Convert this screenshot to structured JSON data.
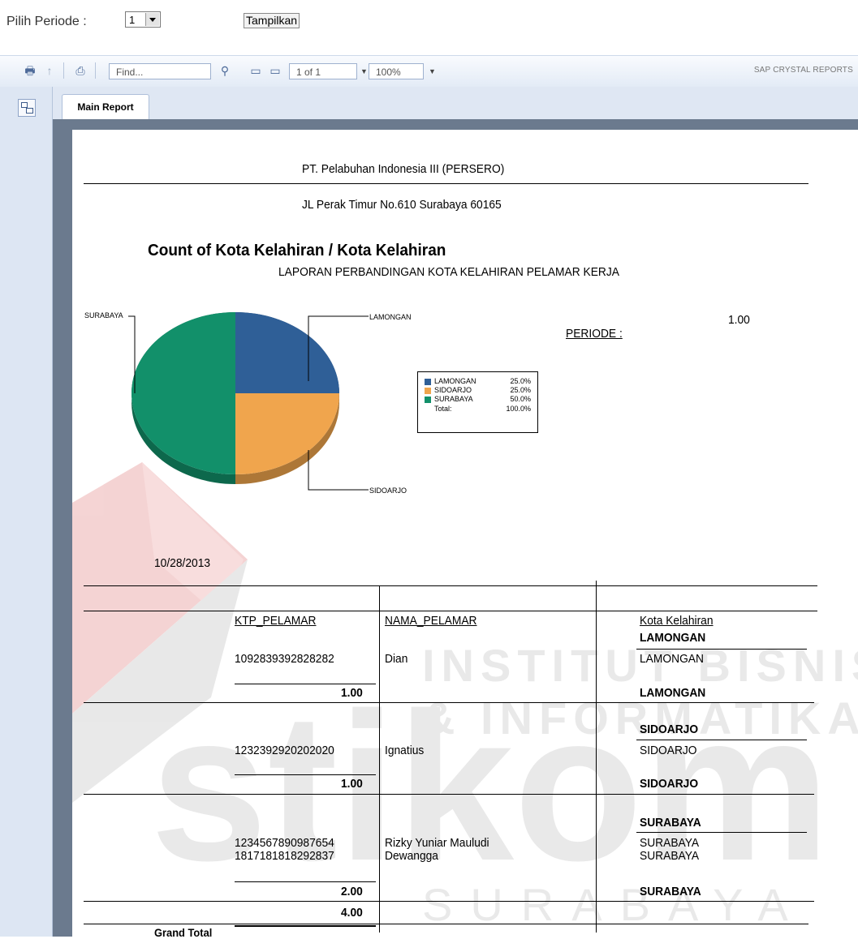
{
  "periode_form": {
    "label": "Pilih Periode :",
    "selected": "1",
    "button": "Tampilkan"
  },
  "toolbar": {
    "find_placeholder": "Find...",
    "page_nav": "1 of 1",
    "zoom": "100%",
    "brand": "SAP CRYSTAL REPORTS"
  },
  "tabs": {
    "main_report": "Main Report"
  },
  "report": {
    "company": "PT. Pelabuhan Indonesia III (PERSERO)",
    "address": "JL Perak Timur No.610 Surabaya 60165",
    "periode_label": "PERIODE :",
    "periode_value": "1.00",
    "date": "10/28/2013",
    "headers": {
      "ktp": "KTP_PELAMAR",
      "nama": "NAMA_PELAMAR",
      "kota": "Kota Kelahiran"
    },
    "groups": [
      {
        "name": "LAMONGAN",
        "ktp": [
          "1092839392828282"
        ],
        "nama": [
          "Dian"
        ],
        "kota": [
          "LAMONGAN"
        ],
        "count": "1.00",
        "footer": "LAMONGAN"
      },
      {
        "name": "SIDOARJO",
        "ktp": [
          "1232392920202020"
        ],
        "nama": [
          "Ignatius"
        ],
        "kota": [
          "SIDOARJO"
        ],
        "count": "1.00",
        "footer": "SIDOARJO"
      },
      {
        "name": "SURABAYA",
        "ktp": [
          "1234567890987654",
          "1817181818292837"
        ],
        "nama": [
          "Rizky Yuniar Mauludi",
          "Dewangga"
        ],
        "kota": [
          "SURABAYA",
          "SURABAYA"
        ],
        "count": "2.00",
        "footer": "SURABAYA"
      }
    ],
    "grand_total_label": "Grand Total",
    "grand_total": "4.00"
  },
  "chart_data": {
    "type": "pie",
    "title": "Count of Kota Kelahiran / Kota Kelahiran",
    "subtitle": "LAPORAN PERBANDINGAN KOTA KELAHIRAN PELAMAR KERJA",
    "categories": [
      "LAMONGAN",
      "SIDOARJO",
      "SURABAYA"
    ],
    "values": [
      25.0,
      25.0,
      50.0
    ],
    "value_labels": [
      "25.0%",
      "25.0%",
      "50.0%"
    ],
    "total_label": "Total:",
    "total": "100.0%",
    "colors": [
      "#2f5f97",
      "#f0a54d",
      "#12906a"
    ],
    "legend": "right"
  },
  "watermark": {
    "line1": "INSTITUT BISNIS",
    "line2": "& INFORMATIKA",
    "brand": "stikom",
    "city": "SURABAYA"
  }
}
